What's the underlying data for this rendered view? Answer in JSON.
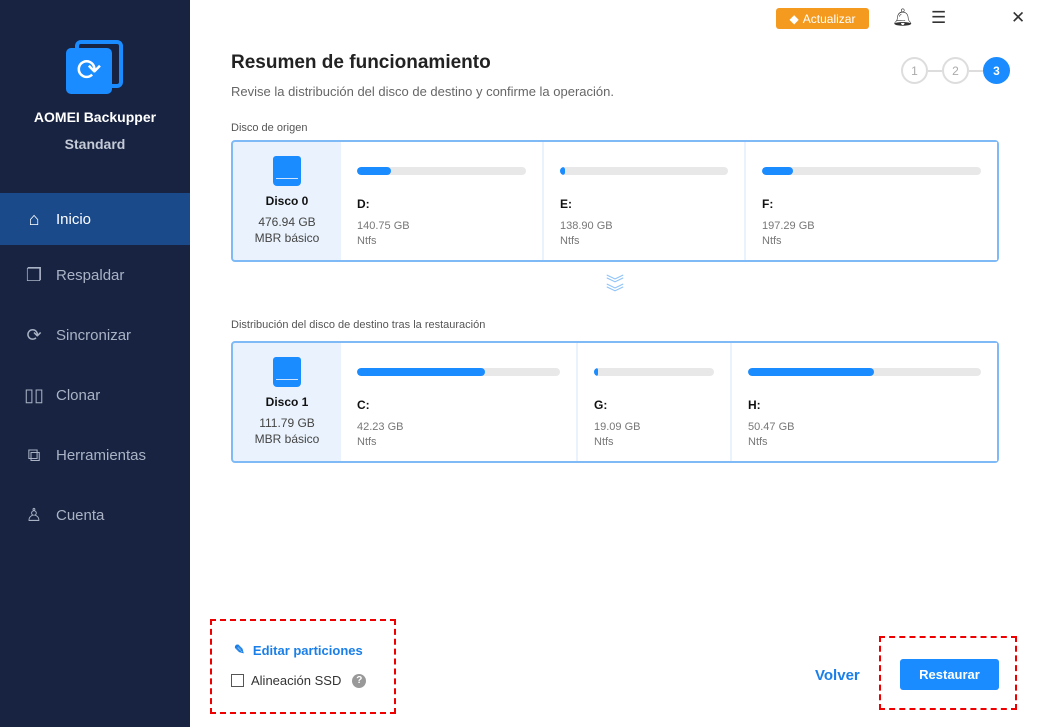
{
  "app": {
    "name": "AOMEI Backupper",
    "edition": "Standard"
  },
  "nav": [
    {
      "label": "Inicio"
    },
    {
      "label": "Respaldar"
    },
    {
      "label": "Sincronizar"
    },
    {
      "label": "Clonar"
    },
    {
      "label": "Herramientas"
    },
    {
      "label": "Cuenta"
    }
  ],
  "topbar": {
    "upgrade": "Actualizar"
  },
  "page": {
    "title": "Resumen de funcionamiento",
    "subtitle": "Revise la distribución del disco de destino y confirme la operación.",
    "steps": [
      "1",
      "2",
      "3"
    ],
    "current_step": 3
  },
  "source": {
    "label": "Disco de origen",
    "disk": {
      "name": "Disco 0",
      "size": "476.94 GB",
      "type": "MBR básico"
    },
    "partitions": [
      {
        "letter": "D:",
        "size": "140.75 GB",
        "fs": "Ntfs",
        "used_pct": 20
      },
      {
        "letter": "E:",
        "size": "138.90 GB",
        "fs": "Ntfs",
        "used_pct": 2
      },
      {
        "letter": "F:",
        "size": "197.29 GB",
        "fs": "Ntfs",
        "used_pct": 14
      }
    ]
  },
  "dest": {
    "label": "Distribución del disco de destino tras la restauración",
    "disk": {
      "name": "Disco 1",
      "size": "111.79 GB",
      "type": "MBR básico"
    },
    "partitions": [
      {
        "letter": "C:",
        "size": "42.23 GB",
        "fs": "Ntfs",
        "used_pct": 63
      },
      {
        "letter": "G:",
        "size": "19.09 GB",
        "fs": "Ntfs",
        "used_pct": 3
      },
      {
        "letter": "H:",
        "size": "50.47 GB",
        "fs": "Ntfs",
        "used_pct": 54
      }
    ]
  },
  "footer": {
    "edit": "Editar particiones",
    "ssd": "Alineación SSD",
    "help": "?",
    "back": "Volver",
    "restore": "Restaurar"
  }
}
